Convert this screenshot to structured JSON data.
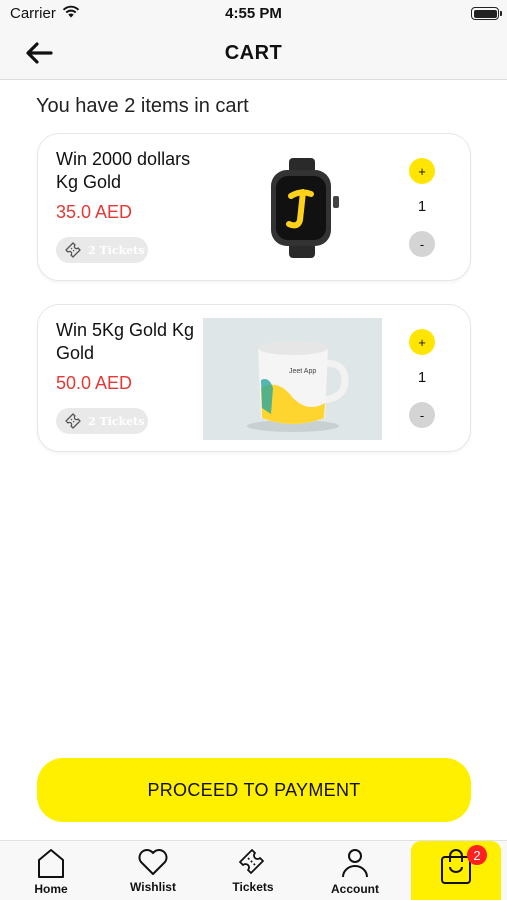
{
  "status_bar": {
    "carrier": "Carrier",
    "time": "4:55 PM"
  },
  "nav": {
    "title": "CART"
  },
  "summary": "You have 2 items in cart",
  "items": [
    {
      "name": "Win 2000 dollars Kg Gold",
      "price": "35.0 AED",
      "tickets": "2 Tickets",
      "qty": "1",
      "plus": "+",
      "minus": "-",
      "image": "smartwatch-image"
    },
    {
      "name": "Win 5Kg Gold Kg Gold",
      "price": "50.0 AED",
      "tickets": "2 Tickets",
      "qty": "1",
      "plus": "+",
      "minus": "-",
      "image": "mug-image",
      "image_text": "Jeet App"
    }
  ],
  "proceed_label": "PROCEED TO PAYMENT",
  "tabs": [
    {
      "label": "Home",
      "icon": "home-icon"
    },
    {
      "label": "Wishlist",
      "icon": "heart-icon"
    },
    {
      "label": "Tickets",
      "icon": "ticket-icon"
    },
    {
      "label": "Account",
      "icon": "person-icon"
    },
    {
      "label": "",
      "icon": "shopping-bag-icon",
      "active": true
    }
  ],
  "cart_badge": "2",
  "colors": {
    "accent": "#fff000",
    "price": "#e53935",
    "badge": "#ff2020"
  }
}
